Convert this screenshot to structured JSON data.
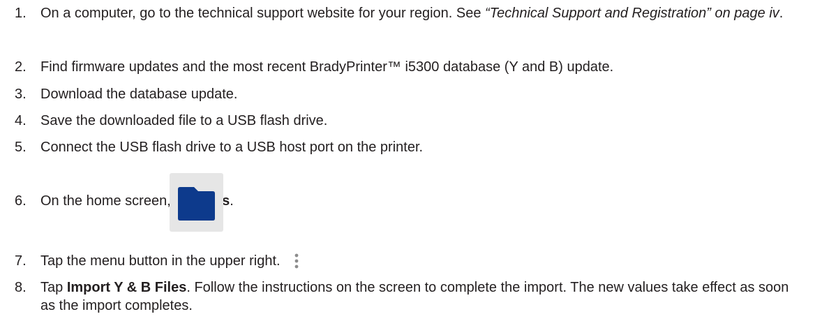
{
  "steps": [
    {
      "number": "1.",
      "text_a": "On a computer, go to the technical support website for your region. See ",
      "link": "“Technical Support and Registration” on page iv",
      "text_b": "."
    },
    {
      "number": "2.",
      "text": "Find firmware updates and the most recent BradyPrinter™ i5300 database (Y and B) update."
    },
    {
      "number": "3.",
      "text": "Download the database update."
    },
    {
      "number": "4.",
      "text": "Save the downloaded file to a USB flash drive."
    },
    {
      "number": "5.",
      "text": "Connect the USB flash drive to a USB host port on the printer."
    },
    {
      "number": "6.",
      "text_a": "On the home screen, tap ",
      "bold": "Files",
      "text_b": ".",
      "icon": "folder-icon"
    },
    {
      "number": "7.",
      "text": "Tap the menu button in the upper right.",
      "icon": "more-vertical-icon"
    },
    {
      "number": "8.",
      "text_a": "Tap ",
      "bold": "Import Y & B Files",
      "text_b": ". Follow the instructions on the screen to complete the import. The new values take effect as soon as the import completes."
    }
  ],
  "colors": {
    "text": "#231f20",
    "folder": "#0d3a8c",
    "tile_bg": "#e6e6e6",
    "kebab_dot": "#8c8c8c"
  }
}
